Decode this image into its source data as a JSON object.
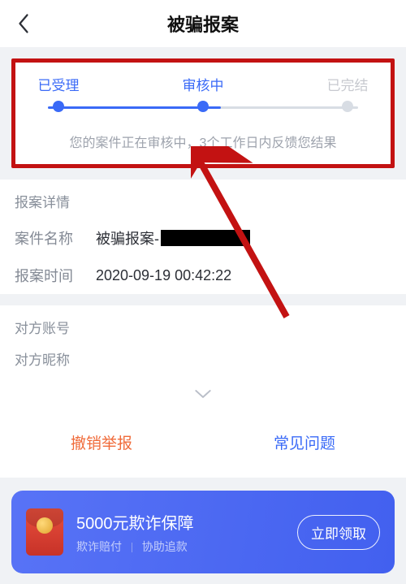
{
  "header": {
    "title": "被骗报案"
  },
  "progress": {
    "steps": [
      {
        "label": "已受理",
        "state": "done"
      },
      {
        "label": "审核中",
        "state": "active"
      },
      {
        "label": "已完结",
        "state": "pending"
      }
    ],
    "status_message": "您的案件正在审核中，3个工作日内反馈您结果"
  },
  "detail": {
    "section_title": "报案详情",
    "rows": {
      "case_name_label": "案件名称",
      "case_name_value": "被骗报案-",
      "report_time_label": "报案时间",
      "report_time_value": "2020-09-19 00:42:22",
      "opponent_account_label": "对方账号",
      "opponent_nickname_label": "对方昵称"
    }
  },
  "actions": {
    "cancel_label": "撤销举报",
    "faq_label": "常见问题"
  },
  "promo": {
    "title": "5000元欺诈保障",
    "sub1": "欺诈赔付",
    "sub2": "协助追款",
    "cta_label": "立即领取"
  },
  "annotation": {
    "highlight_color": "#c31212"
  }
}
